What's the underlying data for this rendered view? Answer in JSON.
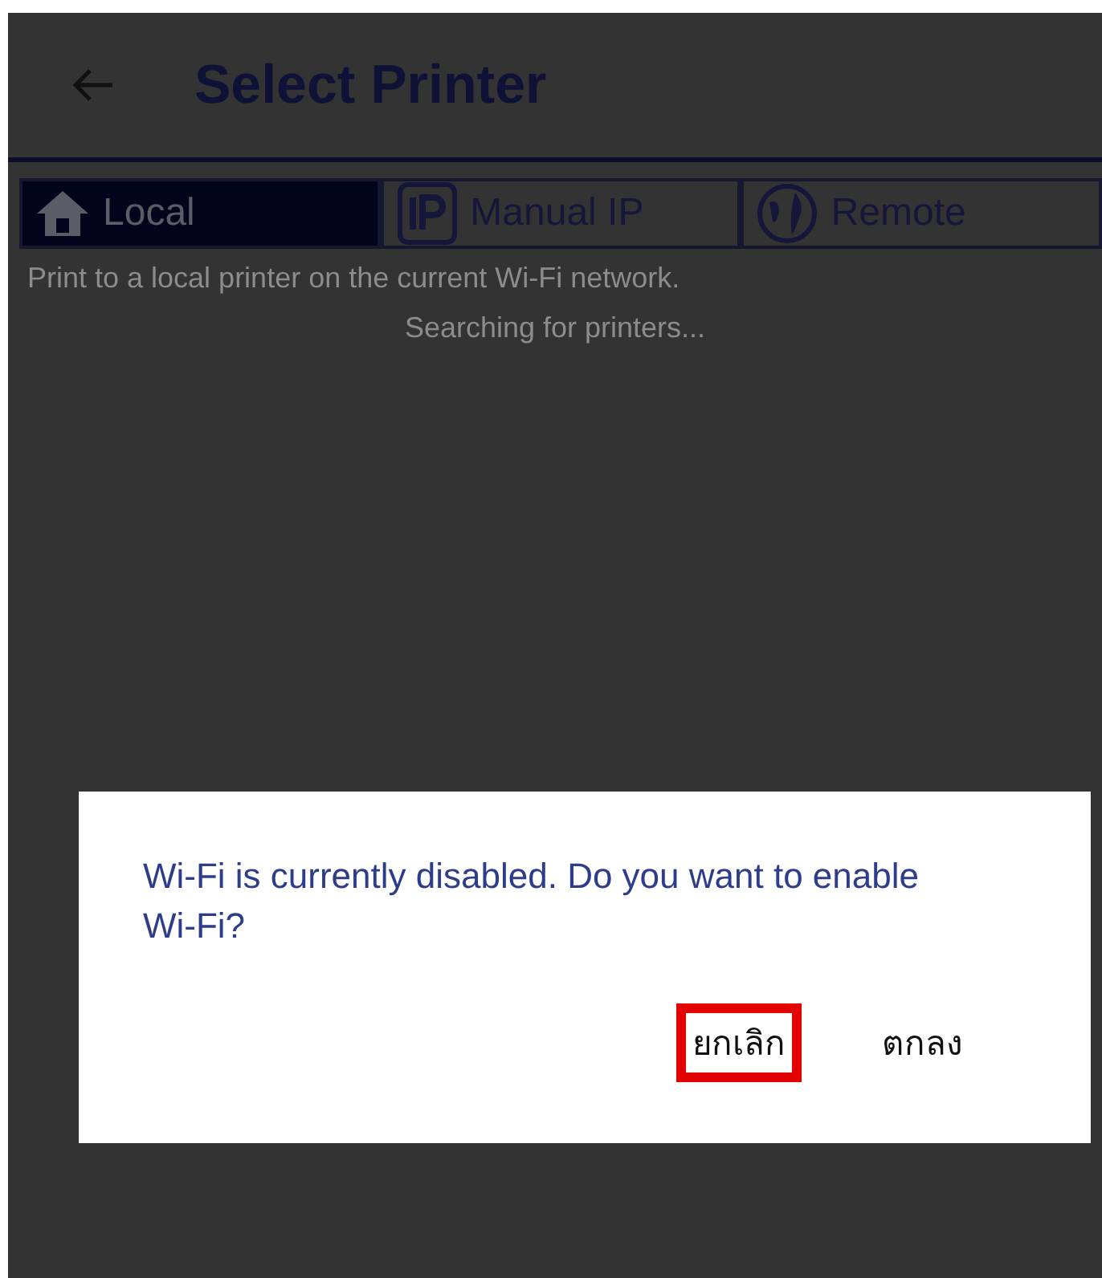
{
  "header": {
    "title": "Select Printer"
  },
  "tabs": [
    {
      "label": "Local",
      "kind": "home",
      "selected": true
    },
    {
      "label": "Manual IP",
      "kind": "ip",
      "selected": false
    },
    {
      "label": "Remote",
      "kind": "globe",
      "selected": false
    }
  ],
  "description": "Print to a local printer on the current Wi-Fi network.",
  "status": "Searching for printers...",
  "dialog": {
    "message": "Wi-Fi is currently disabled. Do you want to enable Wi-Fi?",
    "buttons": [
      {
        "label": "ยกเลิก",
        "highlighted": true
      },
      {
        "label": "ตกลง",
        "highlighted": false
      }
    ]
  }
}
